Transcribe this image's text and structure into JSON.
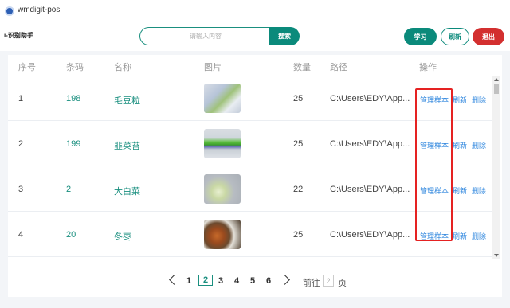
{
  "window": {
    "title": "wmdigit-pos"
  },
  "header": {
    "brand": "i-识别助手",
    "search_placeholder": "请输入内容",
    "search_button": "搜索",
    "learn_button": "学习",
    "refresh_button": "刷新",
    "exit_button": "退出"
  },
  "table": {
    "columns": [
      "序号",
      "条码",
      "名称",
      "图片",
      "数量",
      "路径",
      "操作"
    ],
    "rows": [
      {
        "index": "1",
        "code": "198",
        "name": "毛豆粒",
        "image": "edamame-photo",
        "count": "25",
        "path": "C:\\Users\\EDY\\App..."
      },
      {
        "index": "2",
        "code": "199",
        "name": "韭菜苔",
        "image": "chive-photo",
        "count": "25",
        "path": "C:\\Users\\EDY\\App..."
      },
      {
        "index": "3",
        "code": "2",
        "name": "大白菜",
        "image": "cabbage-photo",
        "count": "22",
        "path": "C:\\Users\\EDY\\App..."
      },
      {
        "index": "4",
        "code": "20",
        "name": "冬枣",
        "image": "jujube-photo",
        "count": "25",
        "path": "C:\\Users\\EDY\\App..."
      }
    ],
    "actions": {
      "manage": "管理样本",
      "refresh": "刷新",
      "delete": "删除"
    }
  },
  "pagination": {
    "pages": [
      "1",
      "2",
      "3",
      "4",
      "5",
      "6"
    ],
    "current": "2",
    "goto_label": "前往",
    "goto_value": "2",
    "goto_suffix": "页"
  },
  "colors": {
    "accent": "#0b8a7b",
    "danger": "#d32f2f",
    "link": "#2e86de",
    "highlight": "#e52222"
  }
}
